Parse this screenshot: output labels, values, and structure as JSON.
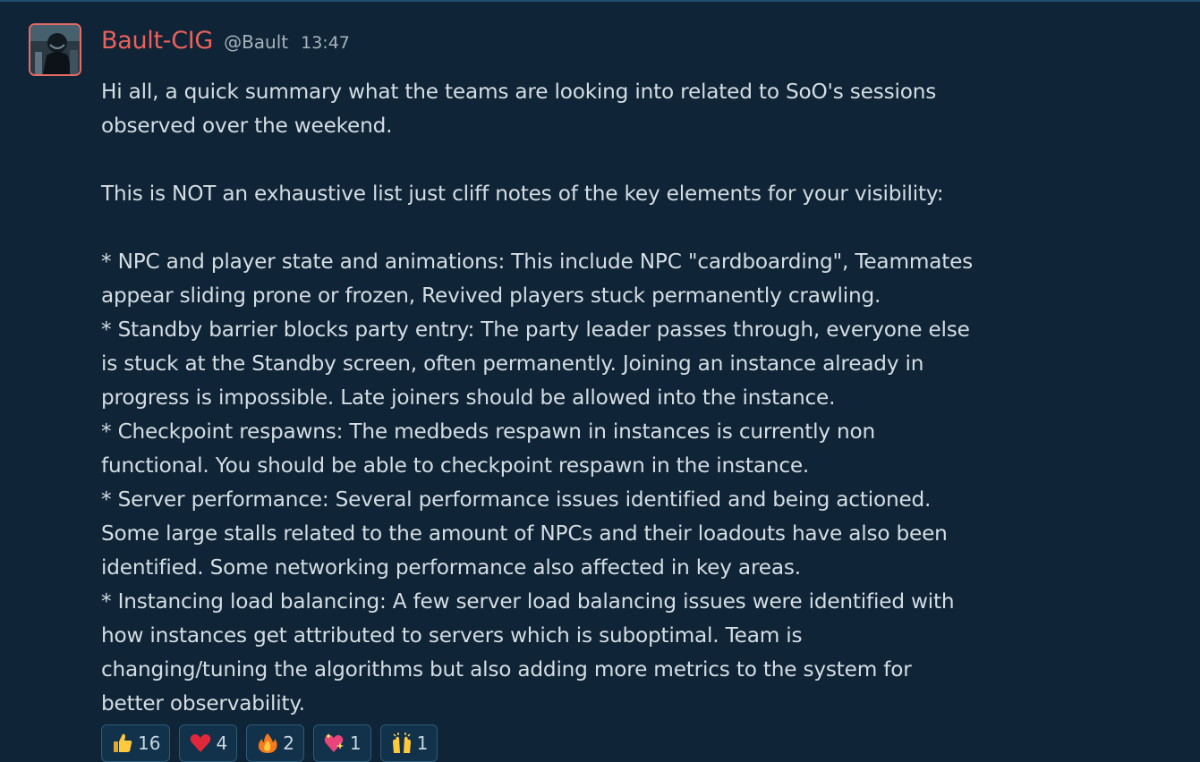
{
  "message": {
    "author": "Bault-CIG",
    "handle": "@Bault",
    "time": "13:47",
    "lines": [
      "Hi all, a quick summary what the teams are looking into related to SoO's sessions",
      "observed over the weekend.",
      "",
      "This is NOT an exhaustive list just cliff notes of the key elements for your visibility:",
      "",
      "* NPC and player state and animations: This include NPC \"cardboarding\", Teammates",
      "appear sliding prone or frozen, Revived players stuck permanently crawling.",
      "* Standby barrier blocks party entry: The party leader passes through, everyone else",
      "is stuck at the Standby screen, often permanently. Joining an instance already in",
      "progress is impossible. Late joiners should be allowed into the instance.",
      "* Checkpoint respawns: The medbeds respawn in instances is currently non",
      "functional. You should be able to checkpoint respawn in the instance.",
      "* Server performance: Several performance issues identified and being actioned.",
      "Some large stalls related to the amount of NPCs and their loadouts have also been",
      "identified. Some networking performance also affected in key areas.",
      "* Instancing load balancing: A few server load balancing issues were identified with",
      "how instances get attributed to servers which is suboptimal. Team is",
      "changing/tuning the algorithms but also adding more metrics to the system for",
      "better observability."
    ],
    "reactions": [
      {
        "icon": "thumbs-up-icon",
        "count": "16"
      },
      {
        "icon": "heart-icon",
        "count": "4"
      },
      {
        "icon": "fire-icon",
        "count": "2"
      },
      {
        "icon": "sparkling-heart-icon",
        "count": "1"
      },
      {
        "icon": "raised-hands-icon",
        "count": "1"
      }
    ]
  },
  "colors": {
    "background": "#0f2436",
    "author": "#ea615c",
    "text": "#d5dde3",
    "meta": "#a6b3bd",
    "reaction_border": "#2c5b78"
  }
}
